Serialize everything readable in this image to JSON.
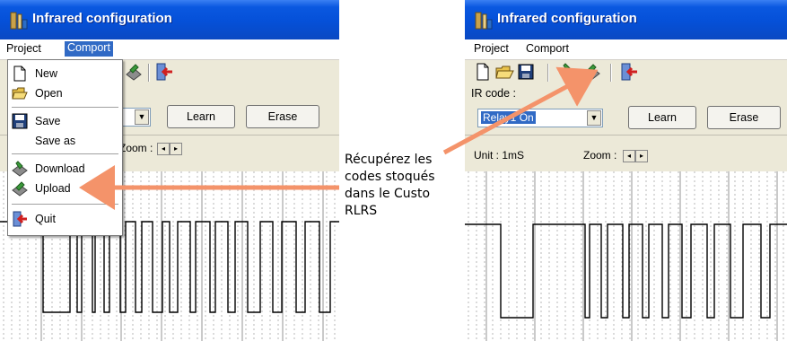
{
  "app_title": "Infrared configuration",
  "menu": {
    "project": "Project",
    "comport": "Comport"
  },
  "popup_menu": {
    "new": "New",
    "open": "Open",
    "save": "Save",
    "save_as": "Save as",
    "download": "Download",
    "upload": "Upload",
    "quit": "Quit"
  },
  "ir_code_label": "IR code :",
  "ir_code_value": "Relay1 On",
  "buttons": {
    "learn": "Learn",
    "erase": "Erase"
  },
  "unit_label": "Unit : 1mS",
  "zoom_label": "Zoom :",
  "zoom_left": "◂",
  "zoom_right": "▸",
  "annotation_lines": [
    "Récupérez les",
    "codes stoqués",
    "dans le Custo",
    "RLRS"
  ],
  "colors": {
    "arrow": "#f4936a",
    "title_bar": "#0550d8",
    "selection": "#316ac5"
  }
}
